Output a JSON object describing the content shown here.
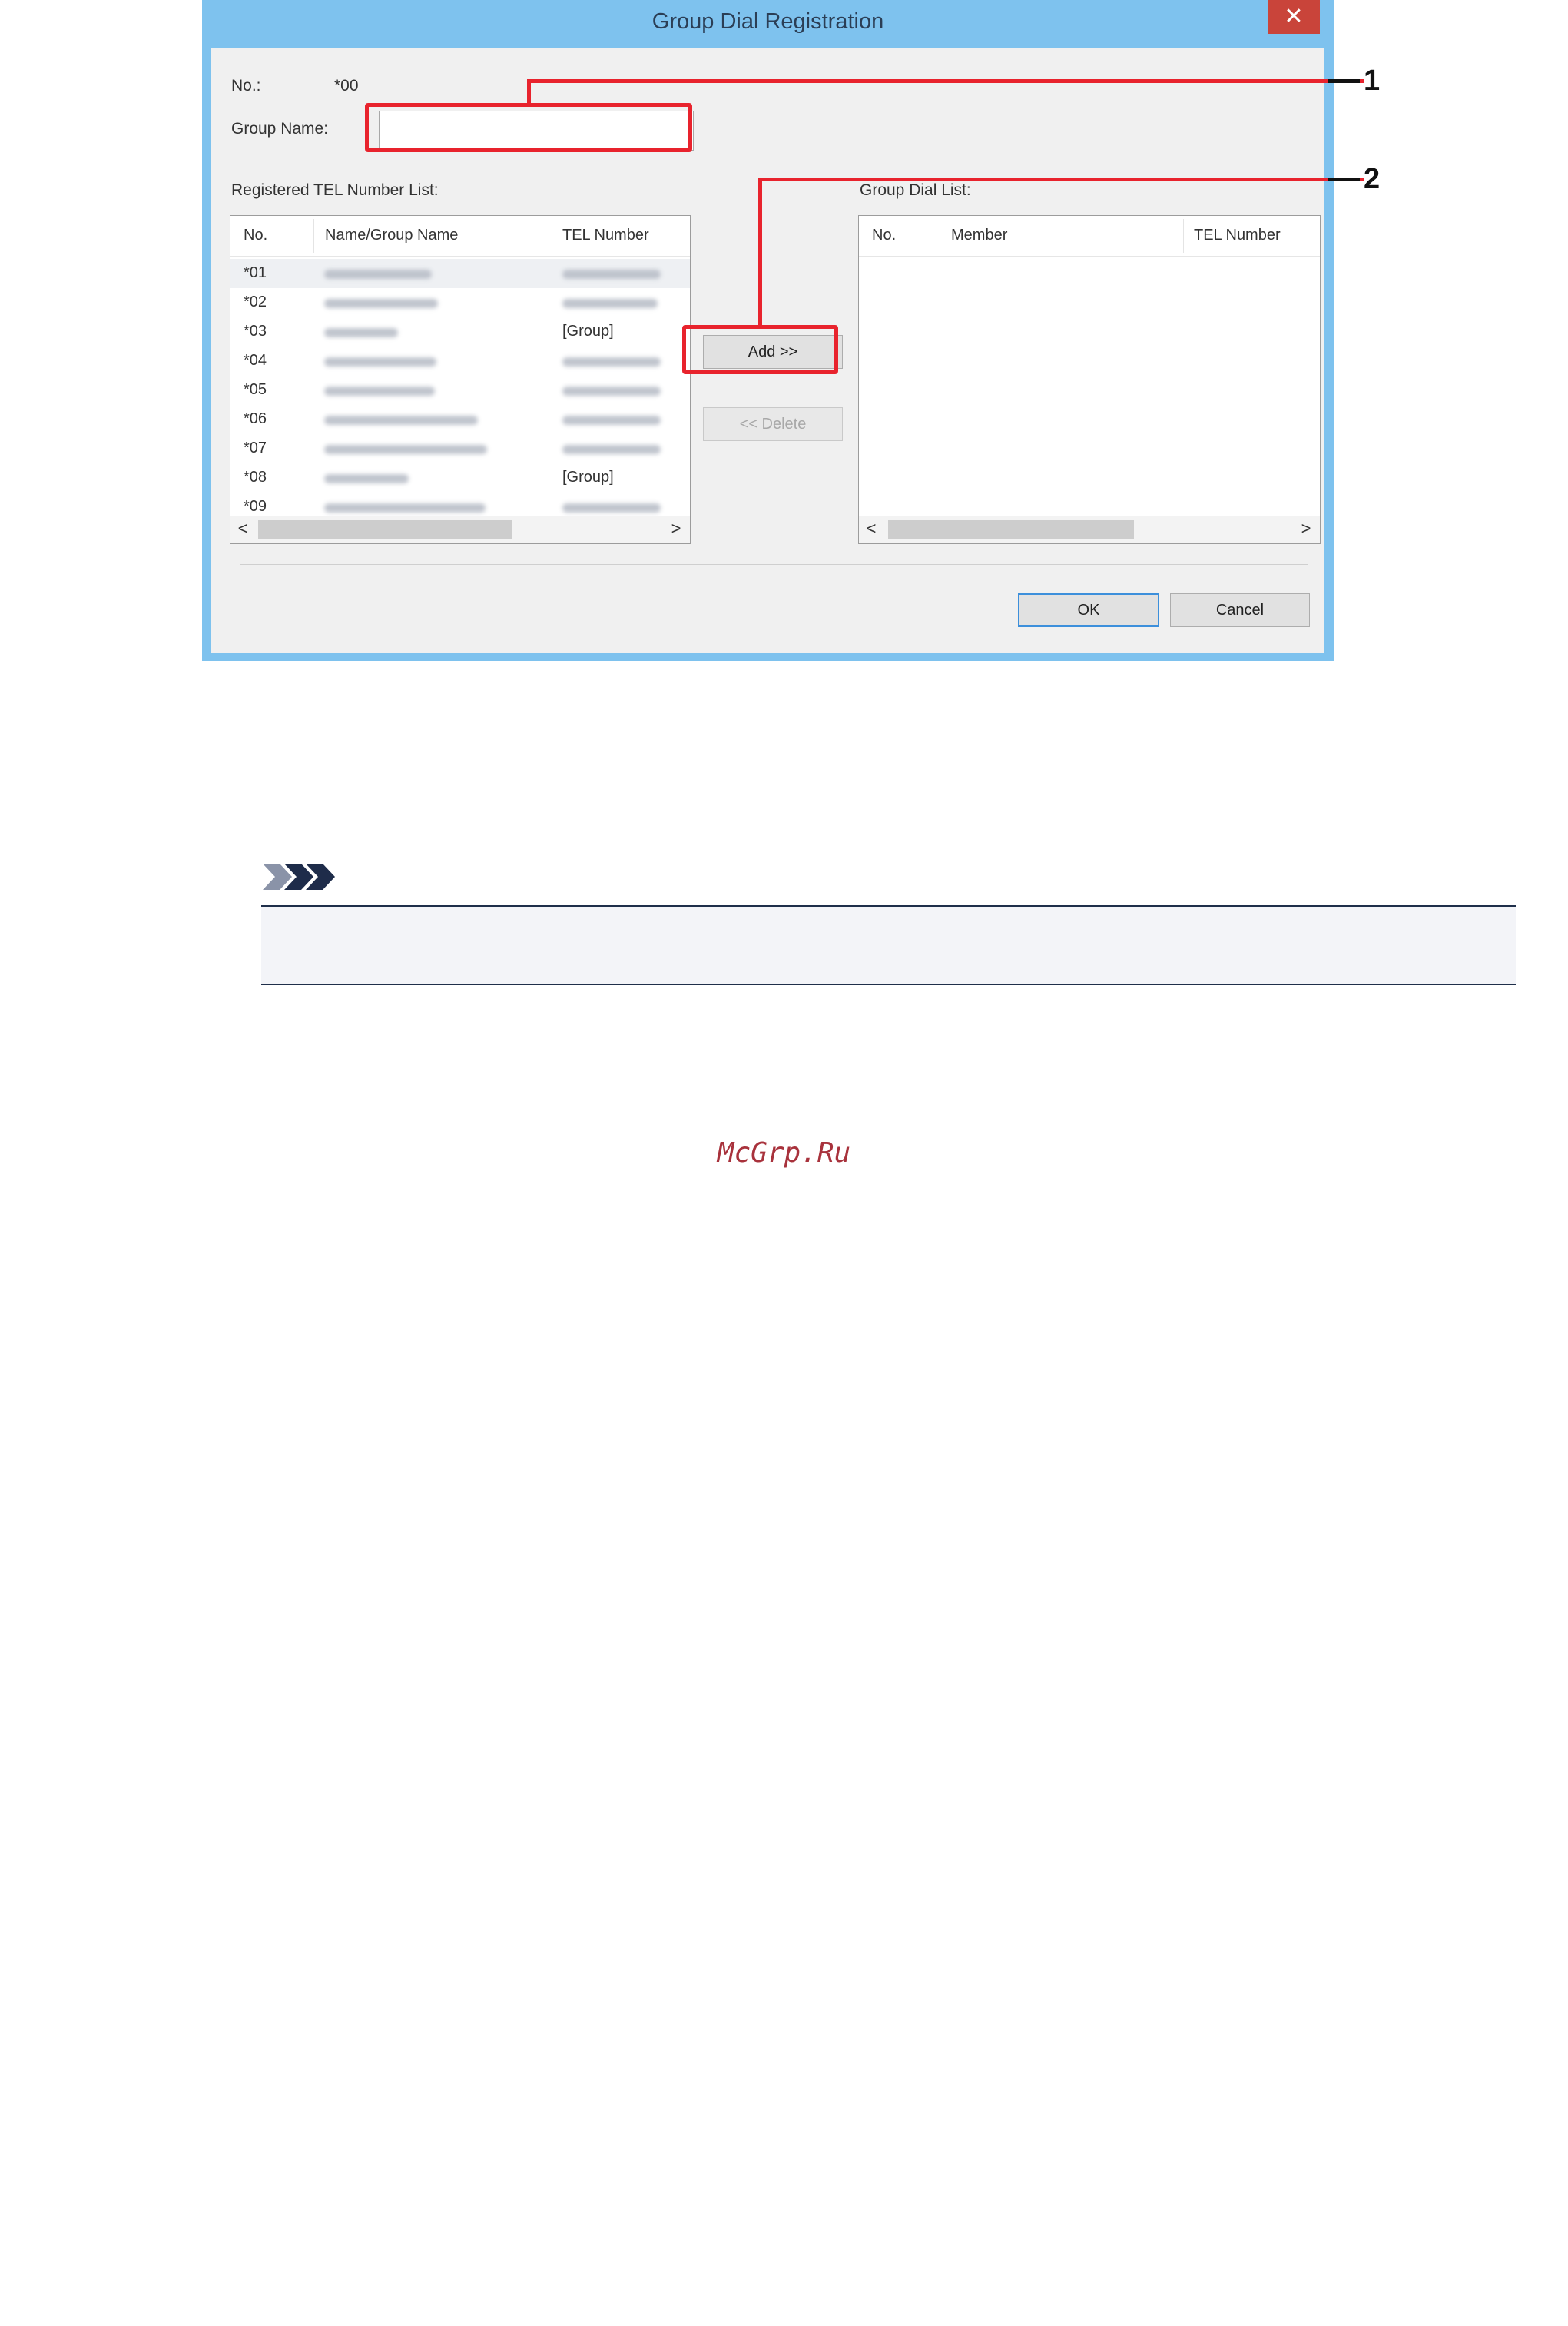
{
  "dialog": {
    "title": "Group Dial Registration",
    "close_glyph": "✕",
    "no_label": "No.:",
    "no_value": "*00",
    "group_name_label": "Group Name:",
    "group_name_value": "",
    "registered_list_label": "Registered TEL Number List:",
    "group_list_label": "Group Dial List:",
    "registered_columns": [
      "No.",
      "Name/Group Name",
      "TEL Number"
    ],
    "group_columns": [
      "No.",
      "Member",
      "TEL Number"
    ],
    "registered_rows": [
      {
        "no": "*01",
        "tel": ""
      },
      {
        "no": "*02",
        "tel": ""
      },
      {
        "no": "*03",
        "tel": "[Group]"
      },
      {
        "no": "*04",
        "tel": ""
      },
      {
        "no": "*05",
        "tel": ""
      },
      {
        "no": "*06",
        "tel": ""
      },
      {
        "no": "*07",
        "tel": ""
      },
      {
        "no": "*08",
        "tel": "[Group]"
      },
      {
        "no": "*09",
        "tel": ""
      }
    ],
    "add_button": "Add >>",
    "delete_button": "<< Delete",
    "ok_button": "OK",
    "cancel_button": "Cancel",
    "scroll_left": "<",
    "scroll_right": ">"
  },
  "callouts": [
    "1",
    "2"
  ],
  "watermark": "McGrp.Ru",
  "colors": {
    "window_frame": "#7ec2ee",
    "callout_red": "#e8232d",
    "close_button": "#c9443a",
    "watermark": "#a8323c"
  }
}
